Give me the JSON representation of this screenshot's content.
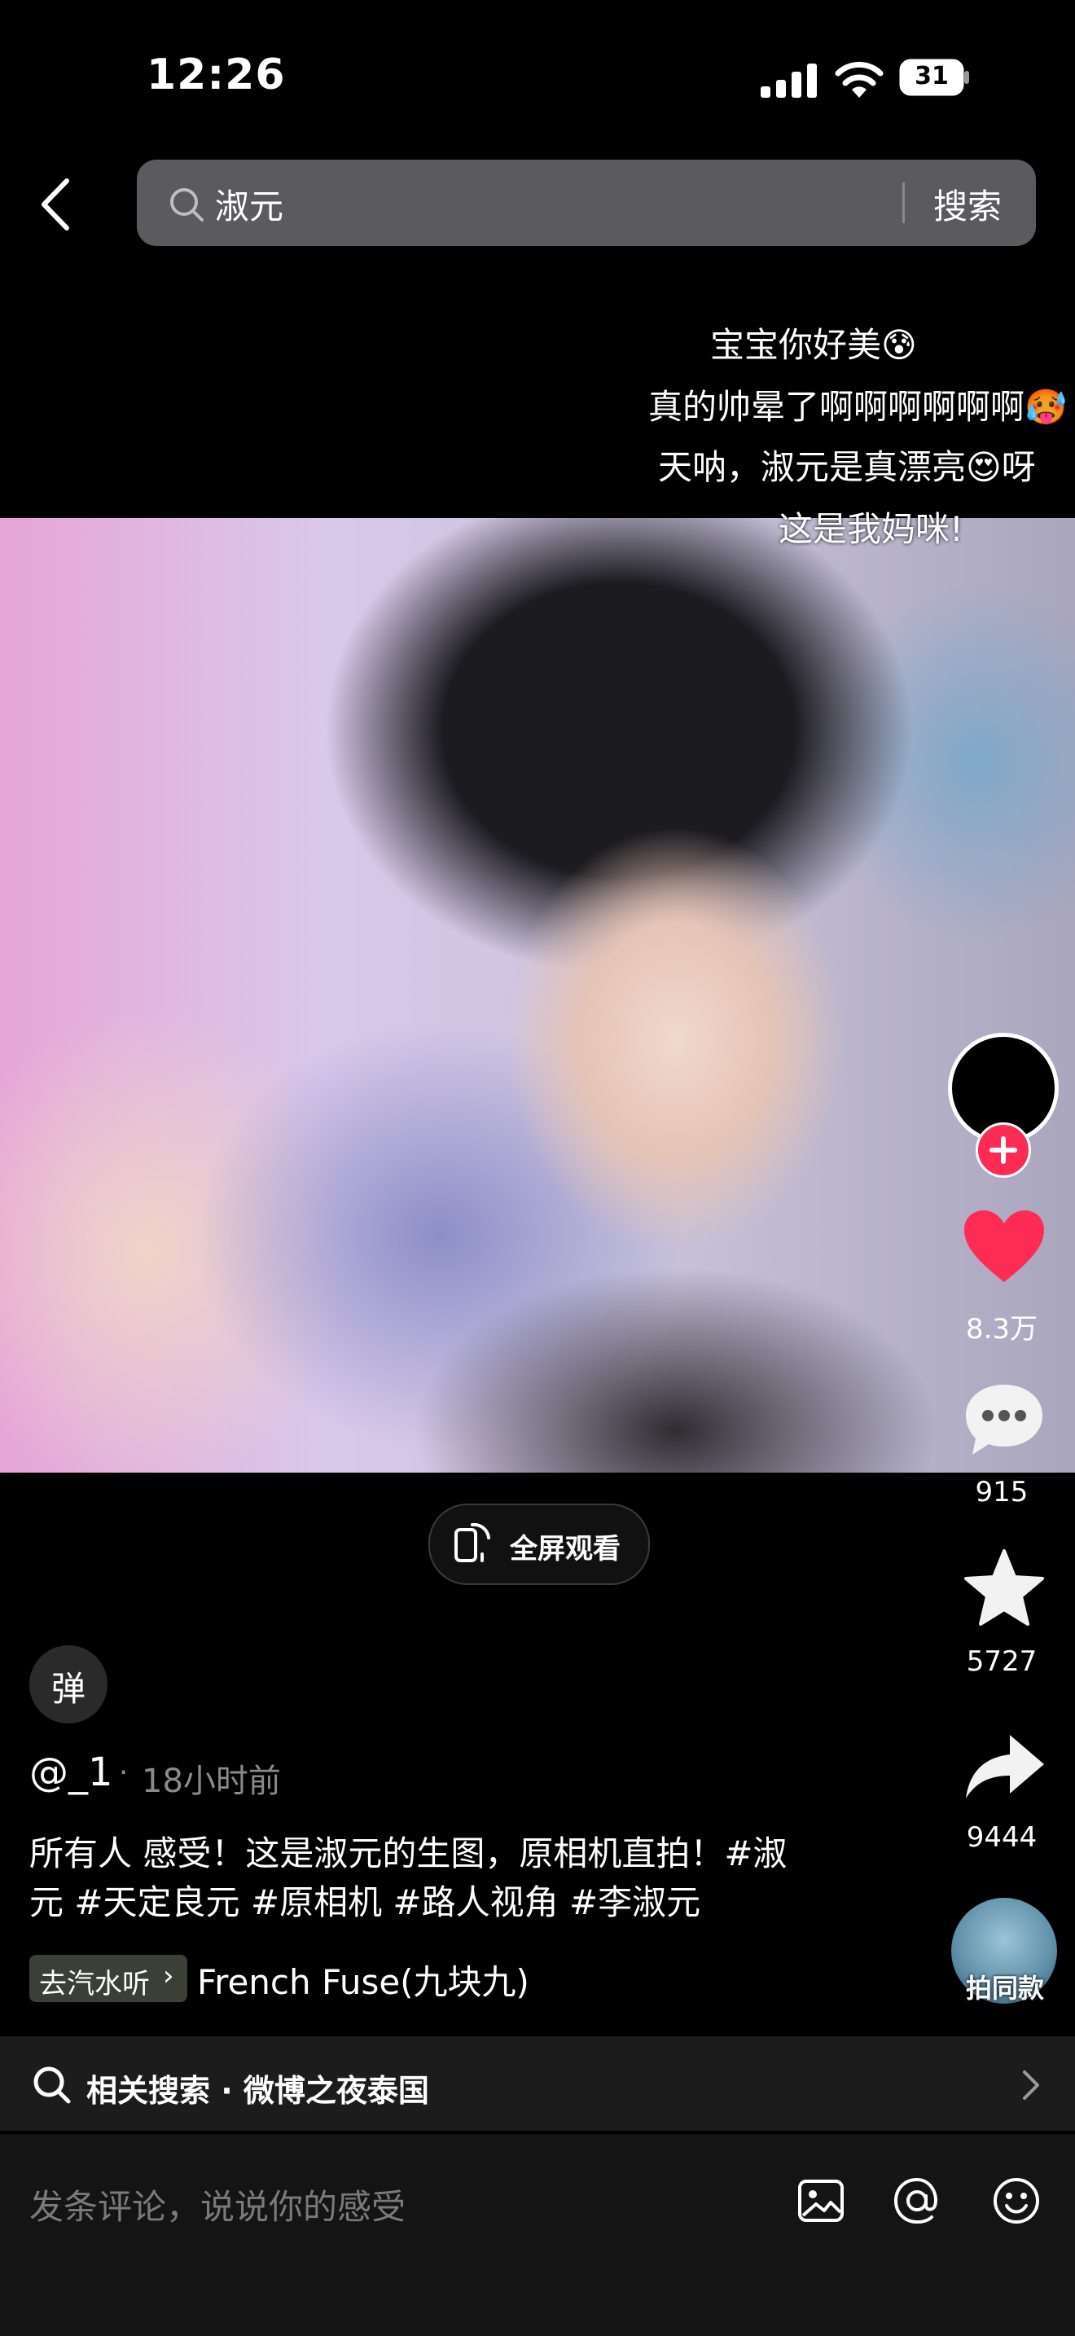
{
  "status_bar": {
    "time": "12:26",
    "battery": "31"
  },
  "search": {
    "query": "淑元",
    "button": "搜索"
  },
  "danmaku": [
    "宝宝你好美😰",
    "真的帅晕了啊啊啊啊啊啊🥵",
    "天呐，淑元是真漂亮😍呀",
    "这是我妈咪!"
  ],
  "video": {
    "fullscreen_label": "全屏观看"
  },
  "rail": {
    "likes": "8.3万",
    "comments": "915",
    "favorites": "5727",
    "shares": "9444",
    "same_style": "拍同款"
  },
  "post": {
    "danmaku_toggle": "弹",
    "username": "@_1",
    "time_ago": "18小时前",
    "caption_line1": "所有人 感受！这是淑元的生图，原相机直拍！#淑",
    "caption_line2": "元 #天定良元 #原相机 #路人视角 #李淑元",
    "music_tag": "去汽水听",
    "music_title": "French Fuse(九块九)"
  },
  "related_search": "相关搜索 · 微博之夜泰国",
  "comment_bar": {
    "placeholder": "发条评论，说说你的感受"
  },
  "colors": {
    "like": "#fe2c55",
    "follow": "#fe2c55",
    "background": "#000000"
  }
}
